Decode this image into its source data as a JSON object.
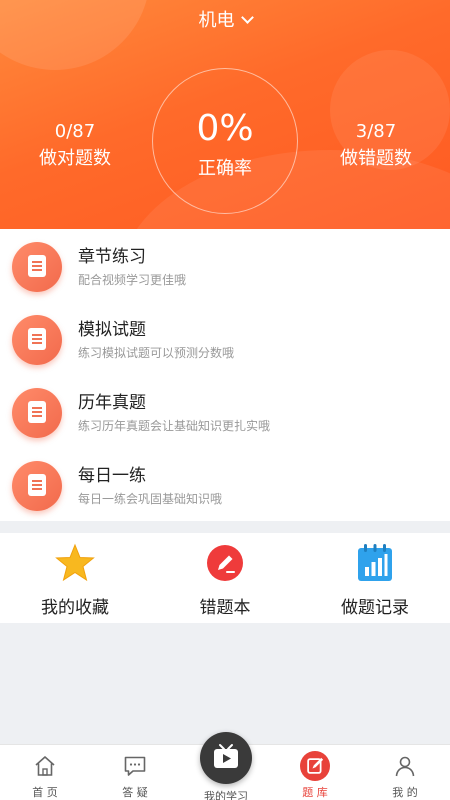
{
  "header": {
    "subject": "机电",
    "accuracy_value": "0%",
    "accuracy_label": "正确率",
    "correct": {
      "value": "0/87",
      "label": "做对题数"
    },
    "wrong": {
      "value": "3/87",
      "label": "做错题数"
    },
    "gradient_colors": [
      "#ff8a3c",
      "#ff5a22"
    ]
  },
  "menu": {
    "items": [
      {
        "title": "章节练习",
        "subtitle": "配合视频学习更佳哦",
        "icon": "document-icon"
      },
      {
        "title": "模拟试题",
        "subtitle": "练习模拟试题可以预测分数哦",
        "icon": "document-icon"
      },
      {
        "title": "历年真题",
        "subtitle": "练习历年真题会让基础知识更扎实哦",
        "icon": "document-icon"
      },
      {
        "title": "每日一练",
        "subtitle": "每日一练会巩固基础知识哦",
        "icon": "document-icon"
      }
    ]
  },
  "tools": {
    "items": [
      {
        "label": "我的收藏",
        "icon": "star-icon",
        "color": "#f8b81f"
      },
      {
        "label": "错题本",
        "icon": "pencil-icon",
        "color": "#ef3b3b"
      },
      {
        "label": "做题记录",
        "icon": "calendar-chart-icon",
        "color": "#2fa2ec"
      }
    ]
  },
  "tabbar": {
    "items": [
      {
        "label": "首 页",
        "icon": "home-icon",
        "active": false
      },
      {
        "label": "答 疑",
        "icon": "chat-icon",
        "active": false
      },
      {
        "label": "我的学习",
        "icon": "play-tv-icon",
        "active": false
      },
      {
        "label": "题 库",
        "icon": "edit-icon",
        "active": true
      },
      {
        "label": "我 的",
        "icon": "user-icon",
        "active": false
      }
    ],
    "active_color": "#e8423a"
  }
}
